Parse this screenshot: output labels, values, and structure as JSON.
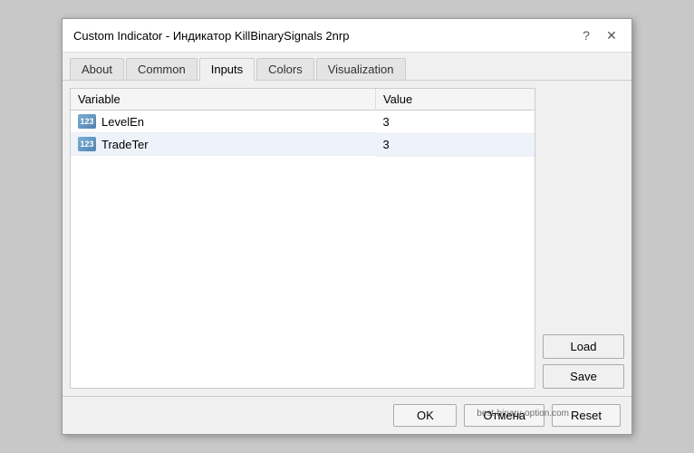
{
  "title": "Custom Indicator - Индикатор KillBinarySignals 2nrp",
  "titleControls": {
    "help": "?",
    "close": "✕"
  },
  "tabs": [
    {
      "label": "About",
      "active": false
    },
    {
      "label": "Common",
      "active": false
    },
    {
      "label": "Inputs",
      "active": true
    },
    {
      "label": "Colors",
      "active": false
    },
    {
      "label": "Visualization",
      "active": false
    }
  ],
  "table": {
    "headers": [
      "Variable",
      "Value"
    ],
    "rows": [
      {
        "icon": "123",
        "variable": "LevelEn",
        "value": "3"
      },
      {
        "icon": "123",
        "variable": "TradeTer",
        "value": "3"
      }
    ]
  },
  "sideButtons": {
    "load": "Load",
    "save": "Save"
  },
  "bottomButtons": {
    "ok": "OK",
    "cancel": "Отмена",
    "reset": "Reset"
  },
  "watermark": "best-binary-option.com"
}
